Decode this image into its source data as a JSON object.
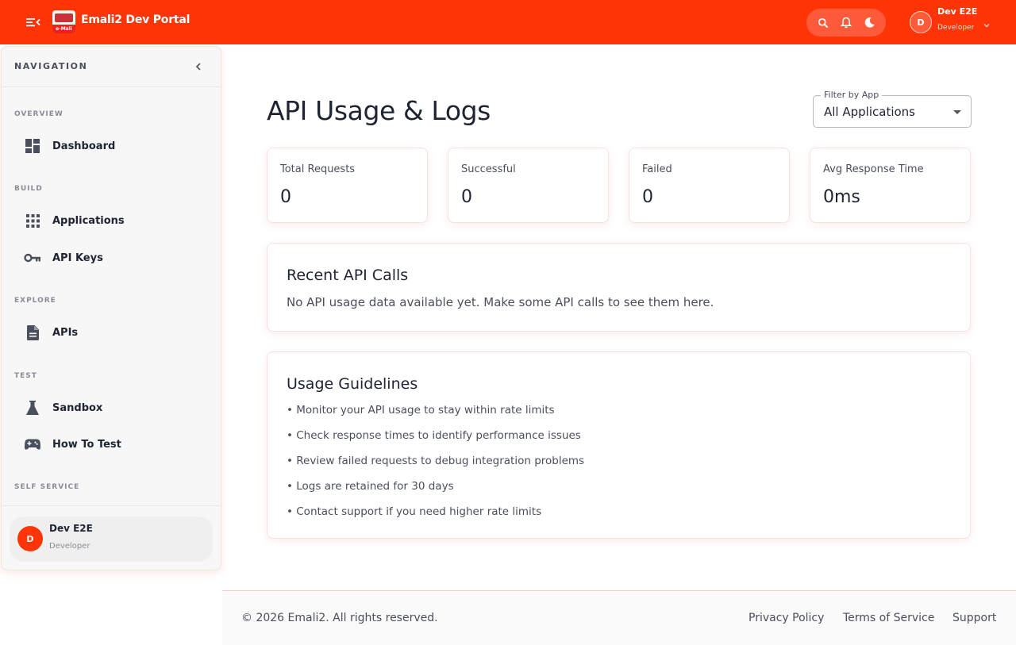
{
  "header": {
    "app_title": "Emali2 Dev Portal",
    "logo_text": "e-Mali",
    "brand_color": "#ff3508",
    "icons": [
      "menu-collapse-icon",
      "search-icon",
      "bell-icon",
      "moon-icon",
      "chevron-down-icon"
    ],
    "user": {
      "initial": "D",
      "name": "Dev E2E",
      "role": "Developer"
    }
  },
  "sidebar": {
    "title": "NAVIGATION",
    "sections": {
      "overview": "OVERVIEW",
      "build": "BUILD",
      "explore": "EXPLORE",
      "test": "TEST",
      "self_service": "SELF SERVICE"
    },
    "items": {
      "dashboard": "Dashboard",
      "applications": "Applications",
      "api_keys": "API Keys",
      "apis": "APIs",
      "sandbox": "Sandbox",
      "how_to_test": "How To Test"
    },
    "user": {
      "initial": "D",
      "name": "Dev E2E",
      "role": "Developer"
    }
  },
  "main": {
    "title": "API Usage & Logs",
    "filter": {
      "label": "Filter by App",
      "value": "All Applications"
    },
    "stats": [
      {
        "label": "Total Requests",
        "value": "0"
      },
      {
        "label": "Successful",
        "value": "0"
      },
      {
        "label": "Failed",
        "value": "0"
      },
      {
        "label": "Avg Response Time",
        "value": "0ms"
      }
    ],
    "recent": {
      "title": "Recent API Calls",
      "empty": "No API usage data available yet. Make some API calls to see them here."
    },
    "guidelines": {
      "title": "Usage Guidelines",
      "items": [
        "• Monitor your API usage to stay within rate limits",
        "• Check response times to identify performance issues",
        "• Review failed requests to debug integration problems",
        "• Logs are retained for 30 days",
        "• Contact support if you need higher rate limits"
      ]
    }
  },
  "footer": {
    "copyright": "© 2026 Emali2. All rights reserved.",
    "links": [
      "Privacy Policy",
      "Terms of Service",
      "Support"
    ]
  }
}
